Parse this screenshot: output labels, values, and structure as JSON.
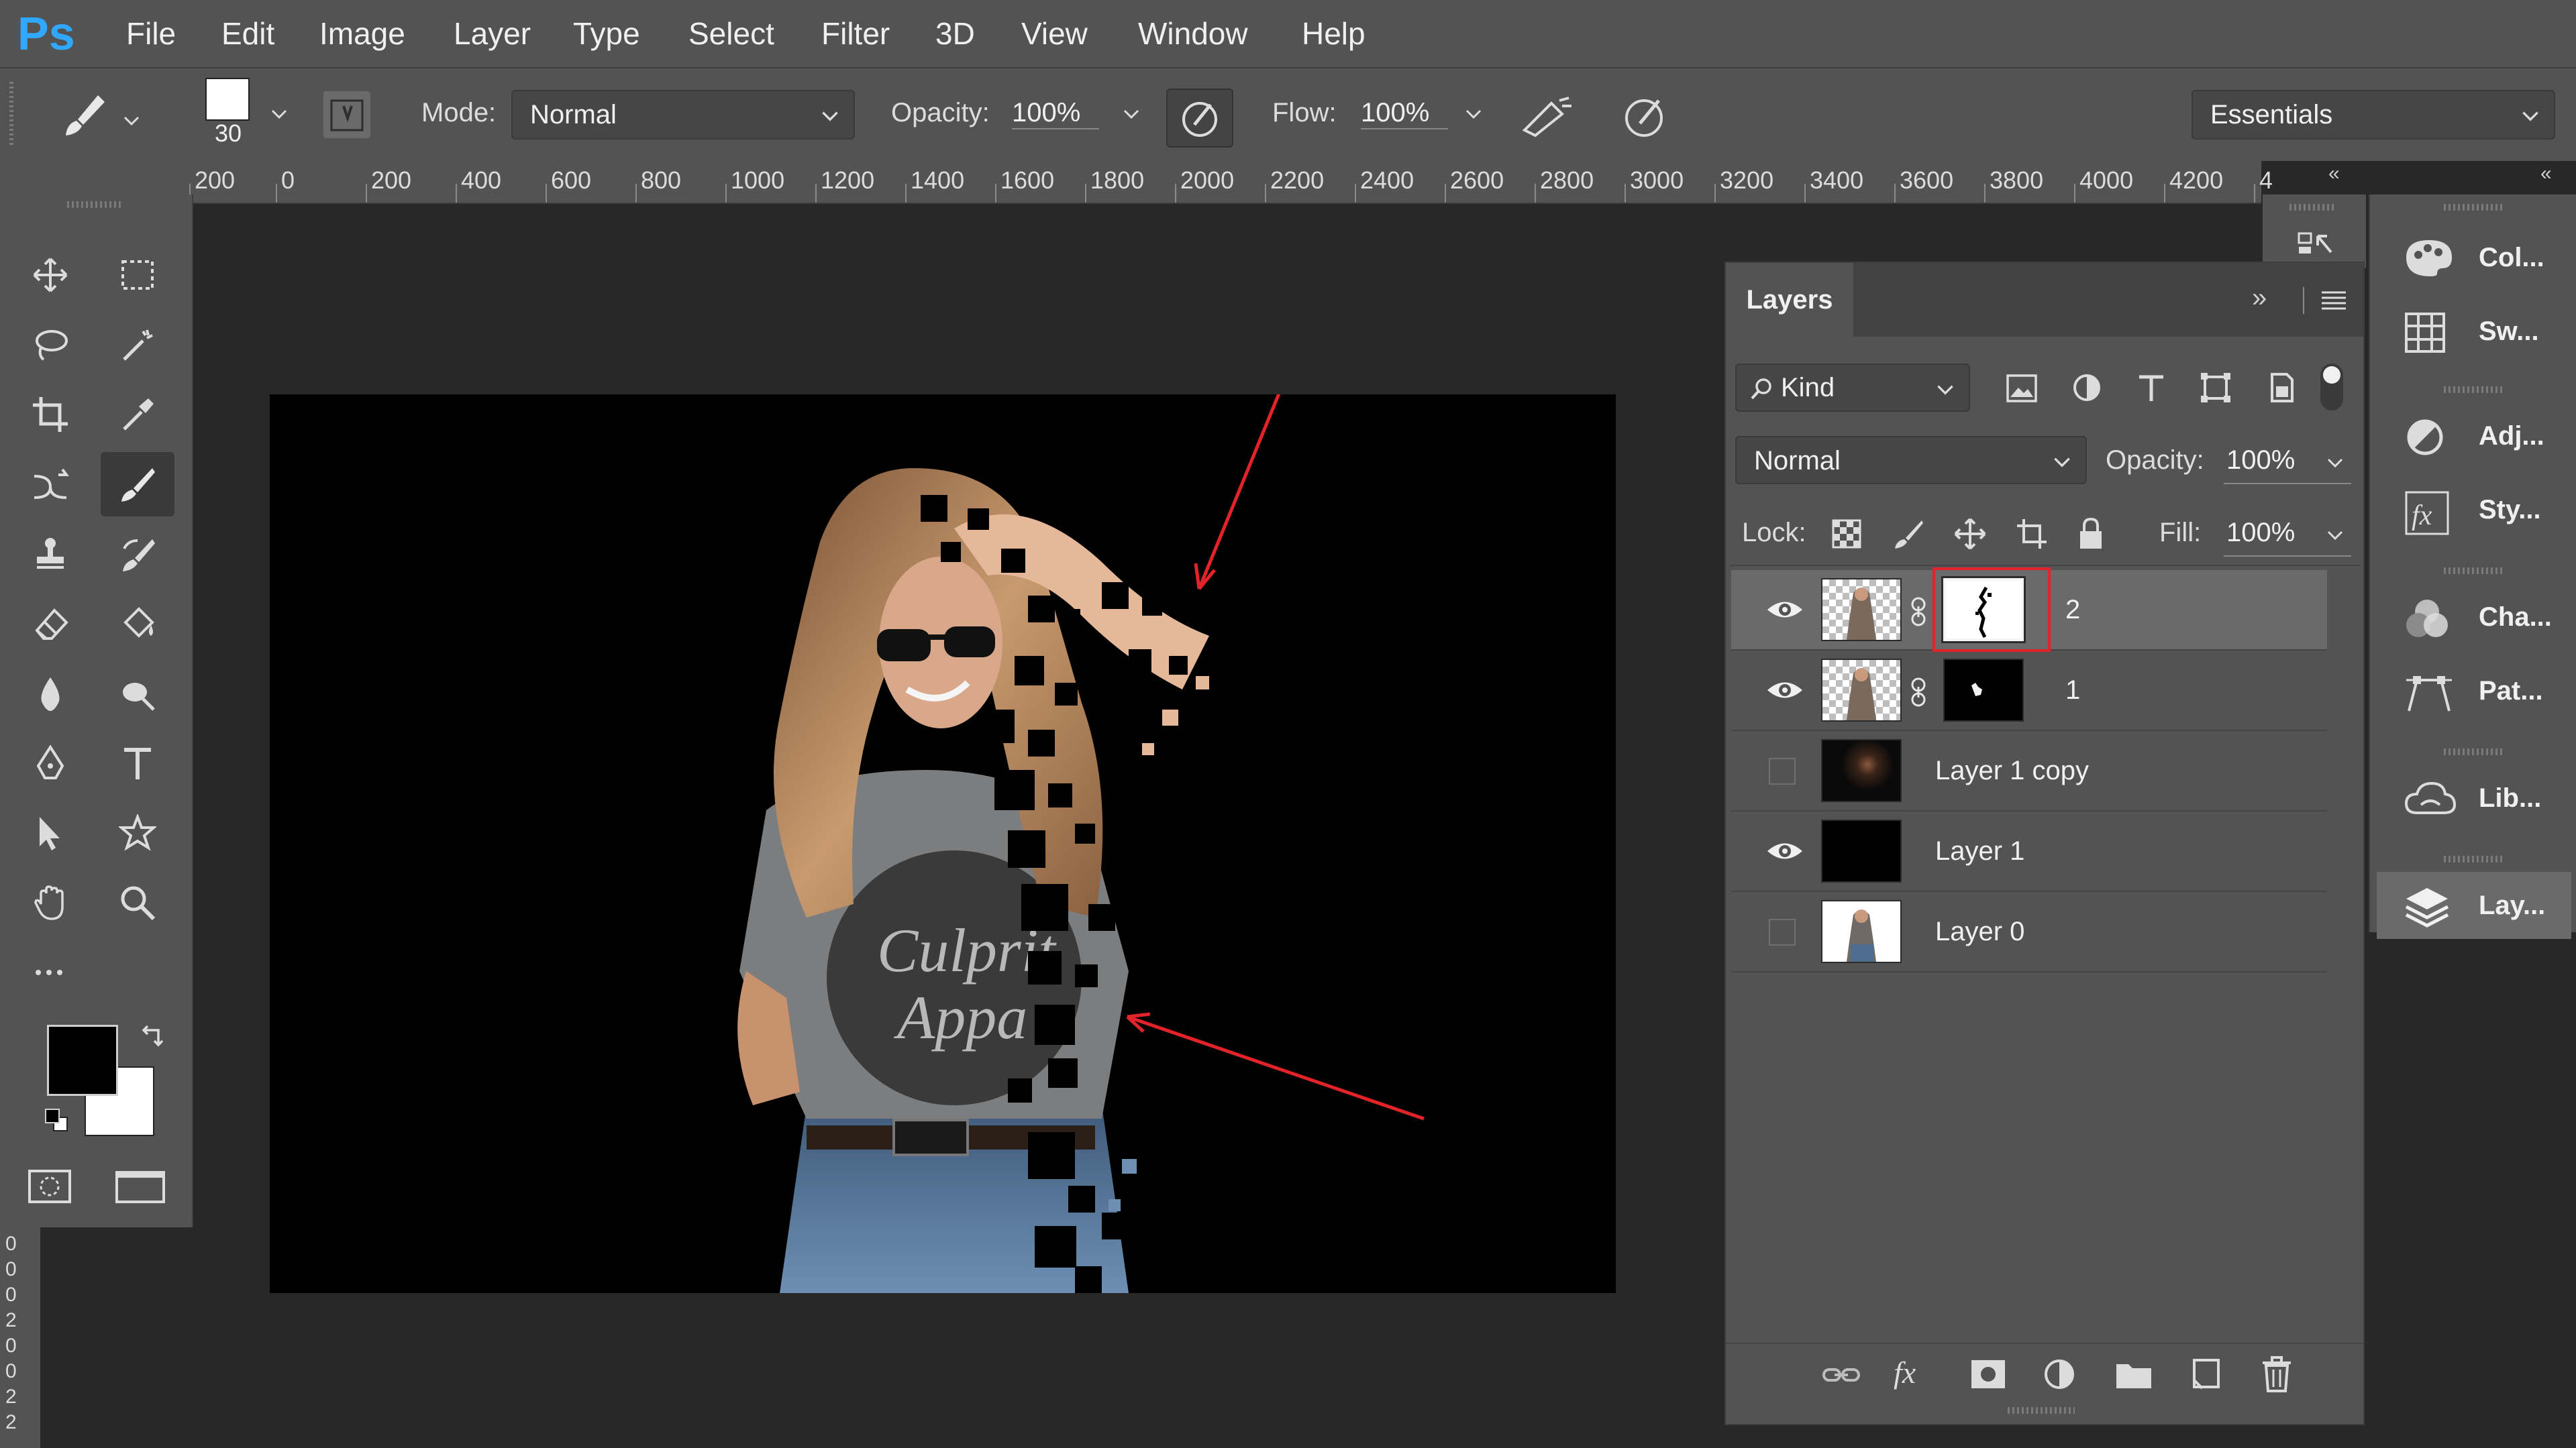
{
  "app": {
    "logo": "Ps"
  },
  "menu": [
    "File",
    "Edit",
    "Image",
    "Layer",
    "Type",
    "Select",
    "Filter",
    "3D",
    "View",
    "Window",
    "Help"
  ],
  "options": {
    "brush_size": "30",
    "mode_label": "Mode:",
    "mode_value": "Normal",
    "opacity_label": "Opacity:",
    "opacity_value": "100%",
    "flow_label": "Flow:",
    "flow_value": "100%",
    "workspace": "Essentials"
  },
  "ruler": [
    "200",
    "0",
    "200",
    "400",
    "600",
    "800",
    "1000",
    "1200",
    "1400",
    "1600",
    "1800",
    "2000",
    "2200",
    "2400",
    "2600",
    "2800",
    "3000",
    "3200",
    "3400",
    "3600",
    "3800",
    "4000",
    "4200",
    "4"
  ],
  "vruler": [
    "0",
    "0",
    "0",
    "2",
    "0",
    "0",
    "2",
    "2"
  ],
  "tools": [
    "move-tool",
    "marquee-tool",
    "lasso-tool",
    "magic-wand-tool",
    "crop-tool",
    "eyedropper-tool",
    "healing-tool",
    "brush-tool",
    "stamp-tool",
    "history-brush-tool",
    "eraser-tool",
    "paint-bucket-tool",
    "blur-tool",
    "dodge-tool",
    "pen-tool",
    "type-tool",
    "path-selection-tool",
    "shape-tool",
    "hand-tool",
    "zoom-tool"
  ],
  "colors": {
    "foreground": "#000000",
    "background": "#ffffff",
    "accent_red": "#e3232a"
  },
  "layers": {
    "tab": "Layers",
    "filter_kind": "Kind",
    "blend_mode": "Normal",
    "opacity_label": "Opacity:",
    "opacity_value": "100%",
    "lock_label": "Lock:",
    "fill_label": "Fill:",
    "fill_value": "100%",
    "items": [
      {
        "name": "2",
        "visible": true,
        "selected": true
      },
      {
        "name": "1",
        "visible": true,
        "selected": false
      },
      {
        "name": "Layer 1 copy",
        "visible": false,
        "selected": false
      },
      {
        "name": "Layer 1",
        "visible": true,
        "selected": false
      },
      {
        "name": "Layer 0",
        "visible": false,
        "selected": false
      }
    ]
  },
  "canvas_text": {
    "shirt_line1": "Culprit",
    "shirt_line2": "Appa"
  },
  "dock": [
    "Col...",
    "Sw...",
    "Adj...",
    "Sty...",
    "Cha...",
    "Pat...",
    "Lib...",
    "Lay..."
  ]
}
